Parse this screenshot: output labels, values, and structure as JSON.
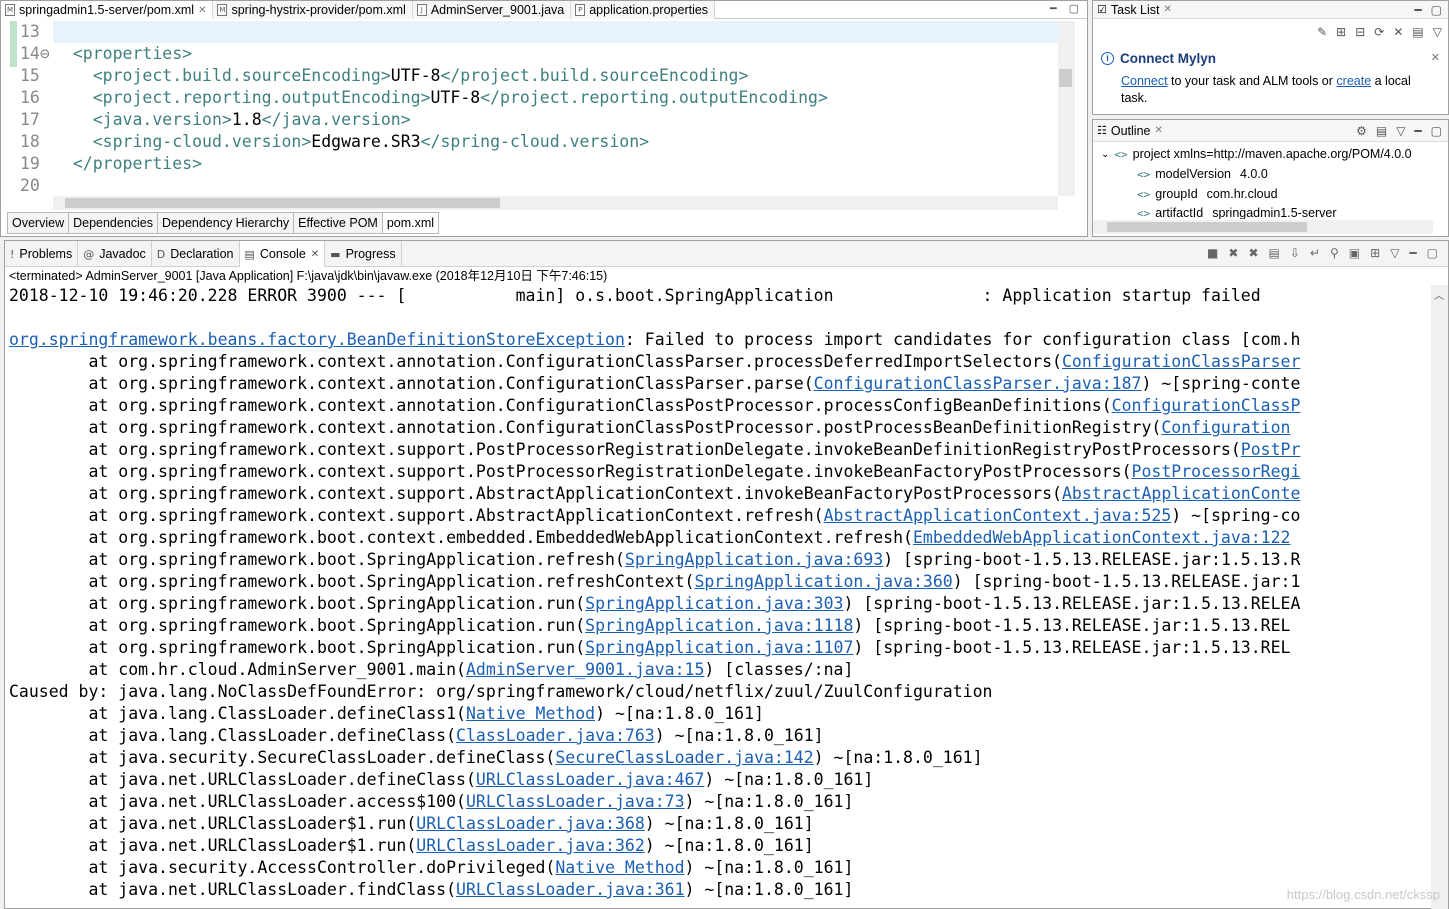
{
  "editor": {
    "tabs": [
      {
        "label": "springadmin1.5-server/pom.xml",
        "icon": "M",
        "active": true,
        "closable": true
      },
      {
        "label": "spring-hystrix-provider/pom.xml",
        "icon": "M"
      },
      {
        "label": "AdminServer_9001.java",
        "icon": "J"
      },
      {
        "label": "application.properties",
        "icon": "P"
      }
    ],
    "line_numbers": [
      "13",
      "14⊖",
      "15",
      "16",
      "17",
      "18",
      "19",
      "20"
    ],
    "code_lines": [
      {
        "indent": "",
        "open": "",
        "value": "",
        "close": ""
      },
      {
        "indent": "  ",
        "open": "<properties>",
        "value": "",
        "close": ""
      },
      {
        "indent": "    ",
        "open": "<project.build.sourceEncoding>",
        "value": "UTF-8",
        "close": "</project.build.sourceEncoding>"
      },
      {
        "indent": "    ",
        "open": "<project.reporting.outputEncoding>",
        "value": "UTF-8",
        "close": "</project.reporting.outputEncoding>"
      },
      {
        "indent": "    ",
        "open": "<java.version>",
        "value": "1.8",
        "close": "</java.version>"
      },
      {
        "indent": "    ",
        "open": "<spring-cloud.version>",
        "value": "Edgware.SR3",
        "close": "</spring-cloud.version>"
      },
      {
        "indent": "  ",
        "open": "</properties>",
        "value": "",
        "close": ""
      },
      {
        "indent": "",
        "open": "",
        "value": "",
        "close": ""
      }
    ],
    "sub_tabs": [
      "Overview",
      "Dependencies",
      "Dependency Hierarchy",
      "Effective POM",
      "pom.xml"
    ]
  },
  "task_list": {
    "tab_label": "Task List",
    "mylyn_title": "Connect Mylyn",
    "text_connect": "Connect",
    "text_middle": " to your task and ALM tools or ",
    "text_create": "create",
    "text_end": " a local task."
  },
  "outline": {
    "tab_label": "Outline",
    "root": "project xmlns=http://maven.apache.org/POM/4.0.0",
    "children": [
      {
        "name": "modelVersion",
        "value": "4.0.0"
      },
      {
        "name": "groupId",
        "value": "com.hr.cloud"
      },
      {
        "name": "artifactId",
        "value": "springadmin1.5-server"
      }
    ]
  },
  "console": {
    "tabs": [
      {
        "label": "Problems",
        "icon": "!"
      },
      {
        "label": "Javadoc",
        "icon": "@"
      },
      {
        "label": "Declaration",
        "icon": "D"
      },
      {
        "label": "Console",
        "icon": "▤",
        "active": true,
        "closable": true
      },
      {
        "label": "Progress",
        "icon": "▬"
      }
    ],
    "status": "<terminated> AdminServer_9001 [Java Application] F:\\java\\jdk\\bin\\javaw.exe (2018年12月10日 下午7:46:15)",
    "lines": [
      {
        "pre": "2018-12-10 19:46:20.228 ERROR 3900 --- [           main] o.s.boot.SpringApplication               : Application startup failed",
        "link": "",
        "post": ""
      },
      {
        "pre": "",
        "link": "",
        "post": ""
      },
      {
        "pre": "",
        "link": "org.springframework.beans.factory.BeanDefinitionStoreException",
        "post": ": Failed to process import candidates for configuration class [com.h"
      },
      {
        "pre": "\tat org.springframework.context.annotation.ConfigurationClassParser.processDeferredImportSelectors(",
        "link": "ConfigurationClassParser",
        "post": ""
      },
      {
        "pre": "\tat org.springframework.context.annotation.ConfigurationClassParser.parse(",
        "link": "ConfigurationClassParser.java:187",
        "post": ") ~[spring-conte"
      },
      {
        "pre": "\tat org.springframework.context.annotation.ConfigurationClassPostProcessor.processConfigBeanDefinitions(",
        "link": "ConfigurationClassP",
        "post": ""
      },
      {
        "pre": "\tat org.springframework.context.annotation.ConfigurationClassPostProcessor.postProcessBeanDefinitionRegistry(",
        "link": "Configuration",
        "post": ""
      },
      {
        "pre": "\tat org.springframework.context.support.PostProcessorRegistrationDelegate.invokeBeanDefinitionRegistryPostProcessors(",
        "link": "PostPr",
        "post": ""
      },
      {
        "pre": "\tat org.springframework.context.support.PostProcessorRegistrationDelegate.invokeBeanFactoryPostProcessors(",
        "link": "PostProcessorRegi",
        "post": ""
      },
      {
        "pre": "\tat org.springframework.context.support.AbstractApplicationContext.invokeBeanFactoryPostProcessors(",
        "link": "AbstractApplicationConte",
        "post": ""
      },
      {
        "pre": "\tat org.springframework.context.support.AbstractApplicationContext.refresh(",
        "link": "AbstractApplicationContext.java:525",
        "post": ") ~[spring-co"
      },
      {
        "pre": "\tat org.springframework.boot.context.embedded.EmbeddedWebApplicationContext.refresh(",
        "link": "EmbeddedWebApplicationContext.java:122",
        "post": ""
      },
      {
        "pre": "\tat org.springframework.boot.SpringApplication.refresh(",
        "link": "SpringApplication.java:693",
        "post": ") [spring-boot-1.5.13.RELEASE.jar:1.5.13.R"
      },
      {
        "pre": "\tat org.springframework.boot.SpringApplication.refreshContext(",
        "link": "SpringApplication.java:360",
        "post": ") [spring-boot-1.5.13.RELEASE.jar:1"
      },
      {
        "pre": "\tat org.springframework.boot.SpringApplication.run(",
        "link": "SpringApplication.java:303",
        "post": ") [spring-boot-1.5.13.RELEASE.jar:1.5.13.RELEA"
      },
      {
        "pre": "\tat org.springframework.boot.SpringApplication.run(",
        "link": "SpringApplication.java:1118",
        "post": ") [spring-boot-1.5.13.RELEASE.jar:1.5.13.REL"
      },
      {
        "pre": "\tat org.springframework.boot.SpringApplication.run(",
        "link": "SpringApplication.java:1107",
        "post": ") [spring-boot-1.5.13.RELEASE.jar:1.5.13.REL"
      },
      {
        "pre": "\tat com.hr.cloud.AdminServer_9001.main(",
        "link": "AdminServer_9001.java:15",
        "post": ") [classes/:na]"
      },
      {
        "pre": "Caused by: java.lang.NoClassDefFoundError: org/springframework/cloud/netflix/zuul/ZuulConfiguration",
        "link": "",
        "post": ""
      },
      {
        "pre": "\tat java.lang.ClassLoader.defineClass1(",
        "link": "Native Method",
        "post": ") ~[na:1.8.0_161]"
      },
      {
        "pre": "\tat java.lang.ClassLoader.defineClass(",
        "link": "ClassLoader.java:763",
        "post": ") ~[na:1.8.0_161]"
      },
      {
        "pre": "\tat java.security.SecureClassLoader.defineClass(",
        "link": "SecureClassLoader.java:142",
        "post": ") ~[na:1.8.0_161]"
      },
      {
        "pre": "\tat java.net.URLClassLoader.defineClass(",
        "link": "URLClassLoader.java:467",
        "post": ") ~[na:1.8.0_161]"
      },
      {
        "pre": "\tat java.net.URLClassLoader.access$100(",
        "link": "URLClassLoader.java:73",
        "post": ") ~[na:1.8.0_161]"
      },
      {
        "pre": "\tat java.net.URLClassLoader$1.run(",
        "link": "URLClassLoader.java:368",
        "post": ") ~[na:1.8.0_161]"
      },
      {
        "pre": "\tat java.net.URLClassLoader$1.run(",
        "link": "URLClassLoader.java:362",
        "post": ") ~[na:1.8.0_161]"
      },
      {
        "pre": "\tat java.security.AccessController.doPrivileged(",
        "link": "Native Method",
        "post": ") ~[na:1.8.0_161]"
      },
      {
        "pre": "\tat java.net.URLClassLoader.findClass(",
        "link": "URLClassLoader.java:361",
        "post": ") ~[na:1.8.0_161]"
      }
    ]
  },
  "watermark": "https://blog.csdn.net/ckssp",
  "colors": {
    "xml_tag": "#3f7f7f",
    "link": "#1a5fb4",
    "current_line": "#e8f2fe"
  }
}
